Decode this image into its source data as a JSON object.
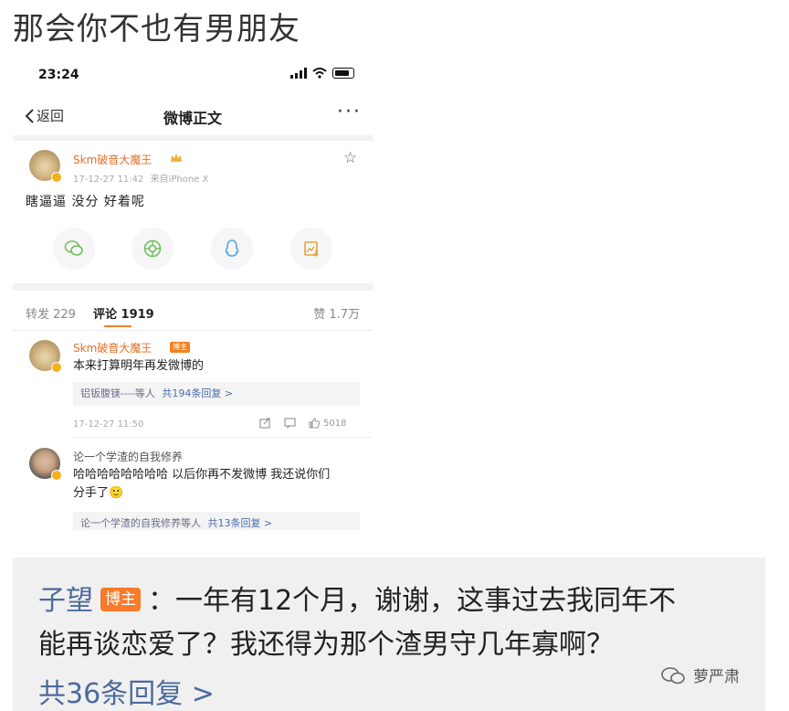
{
  "top_caption": "那会你不也有男朋友",
  "status_bar": {
    "time": "23:24"
  },
  "nav": {
    "back_label": "返回",
    "title": "微博正文",
    "more": "···"
  },
  "post": {
    "author": "Skm破音大魔王",
    "time": "17-12-27 11:42",
    "source": "来自iPhone X",
    "text": "瞎逼逼  没分  好着呢"
  },
  "share_buttons": [
    {
      "icon": "wechat-icon"
    },
    {
      "icon": "moments-icon"
    },
    {
      "icon": "qq-icon"
    },
    {
      "icon": "save-image-icon"
    }
  ],
  "tabs": {
    "repost": "转发 229",
    "comment": "评论 1919",
    "like": "赞 1.7万"
  },
  "comments": [
    {
      "author": "Skm破音大魔王",
      "badge": "博主",
      "text": "本来打算明年再发微博的",
      "reply_summary_name": "铝钣腹镁----等人",
      "reply_summary_count": "共194条回复 >",
      "time": "17-12-27 11:50",
      "likes": "5018"
    },
    {
      "author": "论一个学渣的自我修养",
      "text_line1": "哈哈哈哈哈哈哈哈 以后你再不发微博 我还说你们",
      "text_line2": "分手了🙂",
      "reply_summary_name": "论一个学渣的自我修养等人",
      "reply_summary_count": "共13条回复 >"
    }
  ],
  "bottom_reply": {
    "name": "子望",
    "badge": "博主",
    "line1": "：一年有12个月，谢谢，这事过去我同年不",
    "line2": "能再谈恋爱了？我还得为那个渣男守几年寡啊？",
    "replies": "共36条回复 >"
  },
  "watermark": "萝严肃",
  "colors": {
    "accent_orange": "#f5811f",
    "username_orange": "#e0702c",
    "link_blue": "#4c6a9c",
    "badge_orange": "#f77b2a"
  }
}
